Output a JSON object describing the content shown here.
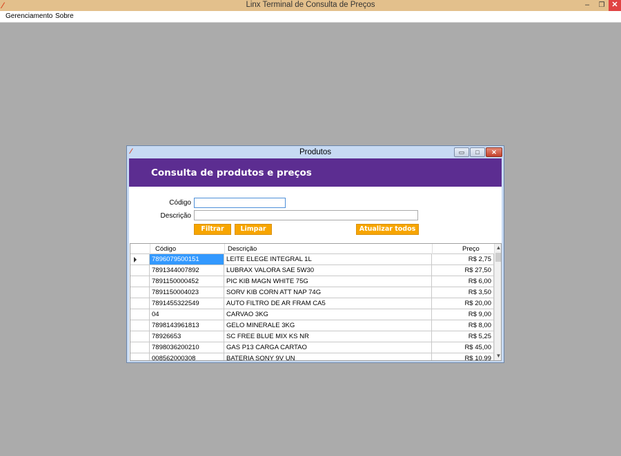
{
  "app": {
    "title": "Linx Terminal de Consulta de Preços",
    "window_buttons": {
      "minimize": "–",
      "maximize": "❐",
      "close": "✕"
    }
  },
  "menu": {
    "items": [
      {
        "label": "Gerenciamento"
      },
      {
        "label": "Sobre"
      }
    ]
  },
  "dialog": {
    "title": "Produtos",
    "banner_title": "Consulta de produtos e preços",
    "form": {
      "codigo_label": "Código",
      "codigo_value": "",
      "descricao_label": "Descrição",
      "descricao_value": ""
    },
    "buttons": {
      "filtrar": "Filtrar",
      "limpar": "Limpar",
      "atualizar": "Atualizar todos"
    },
    "grid": {
      "headers": {
        "codigo": "Código",
        "descricao": "Descrição",
        "preco": "Preço"
      },
      "rows": [
        {
          "codigo": "7896079500151",
          "descricao": "LEITE ELEGE INTEGRAL 1L",
          "preco": "R$ 2,75"
        },
        {
          "codigo": "7891344007892",
          "descricao": "LUBRAX VALORA SAE 5W30",
          "preco": "R$ 27,50"
        },
        {
          "codigo": "7891150000452",
          "descricao": "PIC KIB MAGN WHITE 75G",
          "preco": "R$ 6,00"
        },
        {
          "codigo": "7891150004023",
          "descricao": "SORV KIB CORN ATT NAP 74G",
          "preco": "R$ 3,50"
        },
        {
          "codigo": "7891455322549",
          "descricao": "AUTO FILTRO DE AR FRAM CA5",
          "preco": "R$ 20,00"
        },
        {
          "codigo": "04",
          "descricao": "CARVAO 3KG",
          "preco": "R$ 9,00"
        },
        {
          "codigo": "7898143961813",
          "descricao": "GELO MINERALE 3KG",
          "preco": "R$ 8,00"
        },
        {
          "codigo": "78926653",
          "descricao": "SC FREE BLUE MIX KS NR",
          "preco": "R$ 5,25"
        },
        {
          "codigo": "7898036200210",
          "descricao": "GAS  P13 CARGA CARTAO",
          "preco": "R$ 45,00"
        },
        {
          "codigo": "008562000308",
          "descricao": "BATERIA SONY 9V UN",
          "preco": "R$ 10,99"
        }
      ]
    }
  },
  "colors": {
    "banner": "#5c2d91",
    "button": "#f7a500",
    "selection": "#3399ff",
    "desktop": "#ababab"
  }
}
